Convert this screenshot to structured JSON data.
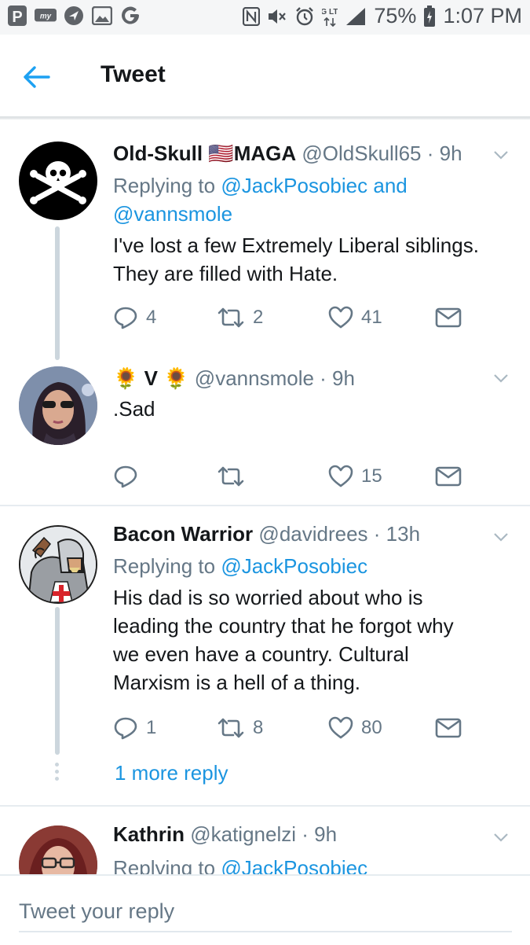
{
  "status_bar": {
    "left_icons": [
      "p-app-icon",
      "my-app-icon",
      "navigation-icon",
      "image-icon",
      "google-icon"
    ],
    "battery": "75%",
    "time": "1:07 PM",
    "network_label": "4G LTE"
  },
  "header": {
    "title": "Tweet"
  },
  "tweets": [
    {
      "name": "Old-Skull 🇺🇸MAGA",
      "handle": "@OldSkull65",
      "time": "· 9h",
      "reply_prefix": "Replying to",
      "reply_to_1": "@JackPosobiec",
      "reply_and": "and",
      "reply_to_2": "@vannsmole",
      "text_1": "I've lost a few Extremely Liberal siblings.",
      "text_2": "They are filled with Hate.",
      "replies": "4",
      "retweets": "2",
      "likes": "41"
    },
    {
      "name_prefix": "🌻",
      "name": "V",
      "name_suffix": "🌻",
      "handle": "@vannsmole",
      "time": "· 9h",
      "text_1": ".Sad",
      "replies": "",
      "retweets": "",
      "likes": "15"
    },
    {
      "name": "Bacon Warrior",
      "handle": "@davidrees",
      "time": "· 13h",
      "reply_prefix": "Replying to",
      "reply_to_1": "@JackPosobiec",
      "text_1": "His dad is so worried about who is",
      "text_2": "leading the country that he forgot why",
      "text_3": "we even have a country. Cultural",
      "text_4": "Marxism is a hell of a thing.",
      "replies": "1",
      "retweets": "8",
      "likes": "80",
      "more_replies": "1 more reply"
    },
    {
      "name": "Kathrin",
      "handle": "@katignelzi",
      "time": "· 9h",
      "reply_prefix": "Replying to",
      "reply_to_1": "@JackPosobiec"
    }
  ],
  "compose": {
    "placeholder": "Tweet your reply"
  },
  "colors": {
    "link": "#1b95e0",
    "muted": "#657786",
    "text": "#14171a",
    "divider": "#e6ecf0"
  }
}
